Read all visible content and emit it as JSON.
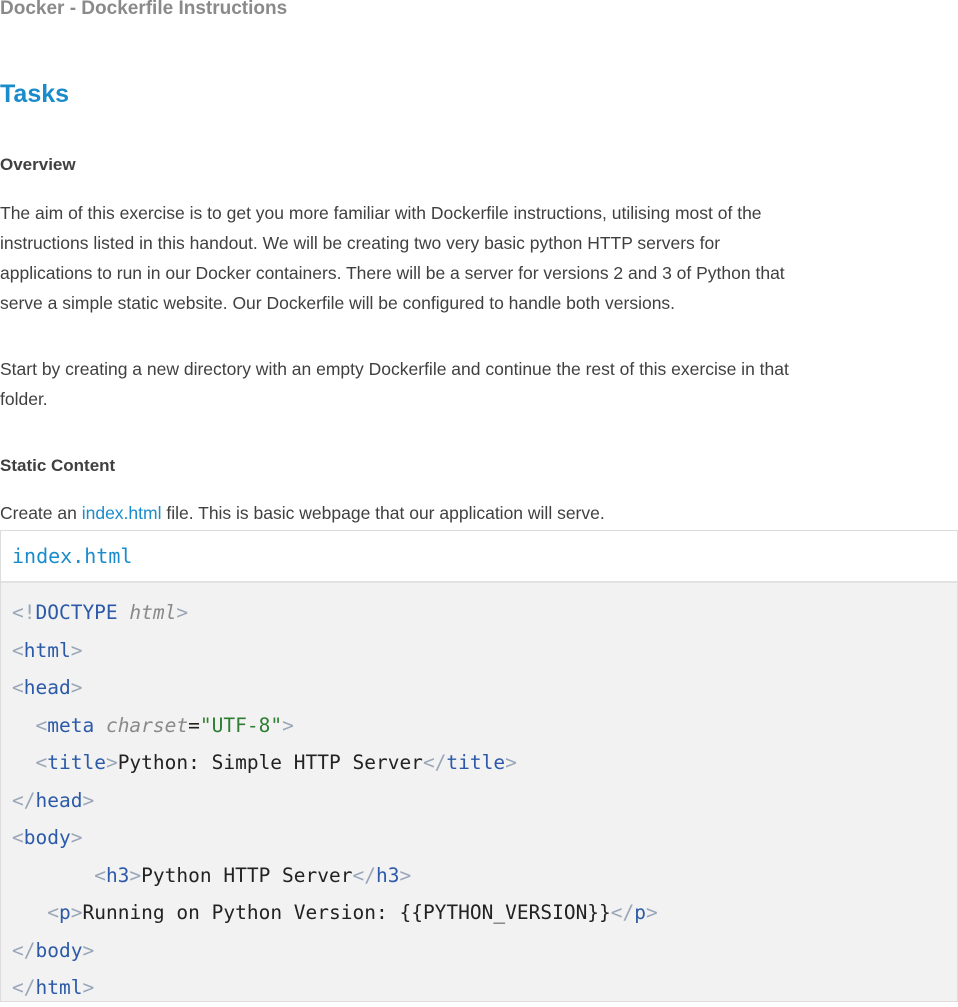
{
  "document": {
    "header": "Docker - Dockerfile Instructions",
    "section_title": "Tasks",
    "overview": {
      "heading": "Overview",
      "lines": [
        "The aim of this exercise is to get you more familiar with Dockerfile instructions, utilising most of the",
        "instructions listed in this handout. We will be creating two very basic python HTTP servers for",
        "applications to run in our Docker containers. There will be a server for versions 2 and 3 of Python that",
        "serve a simple static website. Our Dockerfile will be configured to handle both versions."
      ],
      "start_lines": [
        "Start by creating a new directory with an empty Dockerfile and continue the rest of this exercise in that",
        "folder."
      ]
    },
    "static_content": {
      "heading": "Static Content",
      "intro_prefix": "Create an ",
      "intro_link": "index.html",
      "intro_suffix": " file. This is basic webpage that our application will serve."
    },
    "code_block": {
      "filename": "index.html",
      "doctype_open": "<!",
      "doctype_tag": "DOCTYPE",
      "doctype_attr": "html",
      "lt": "<",
      "gt": ">",
      "lts": "</",
      "eq": "=",
      "tag_html": "html",
      "tag_head": "head",
      "tag_meta": "meta",
      "attr_charset": "charset",
      "charset_value": "\"UTF-8\"",
      "tag_title": "title",
      "title_text": "Python: Simple HTTP Server",
      "tag_body": "body",
      "tag_h3": "h3",
      "h3_text": "Python HTTP Server",
      "tag_p": "p",
      "p_text": "Running on Python Version: {{PYTHON_VERSION}}"
    }
  }
}
